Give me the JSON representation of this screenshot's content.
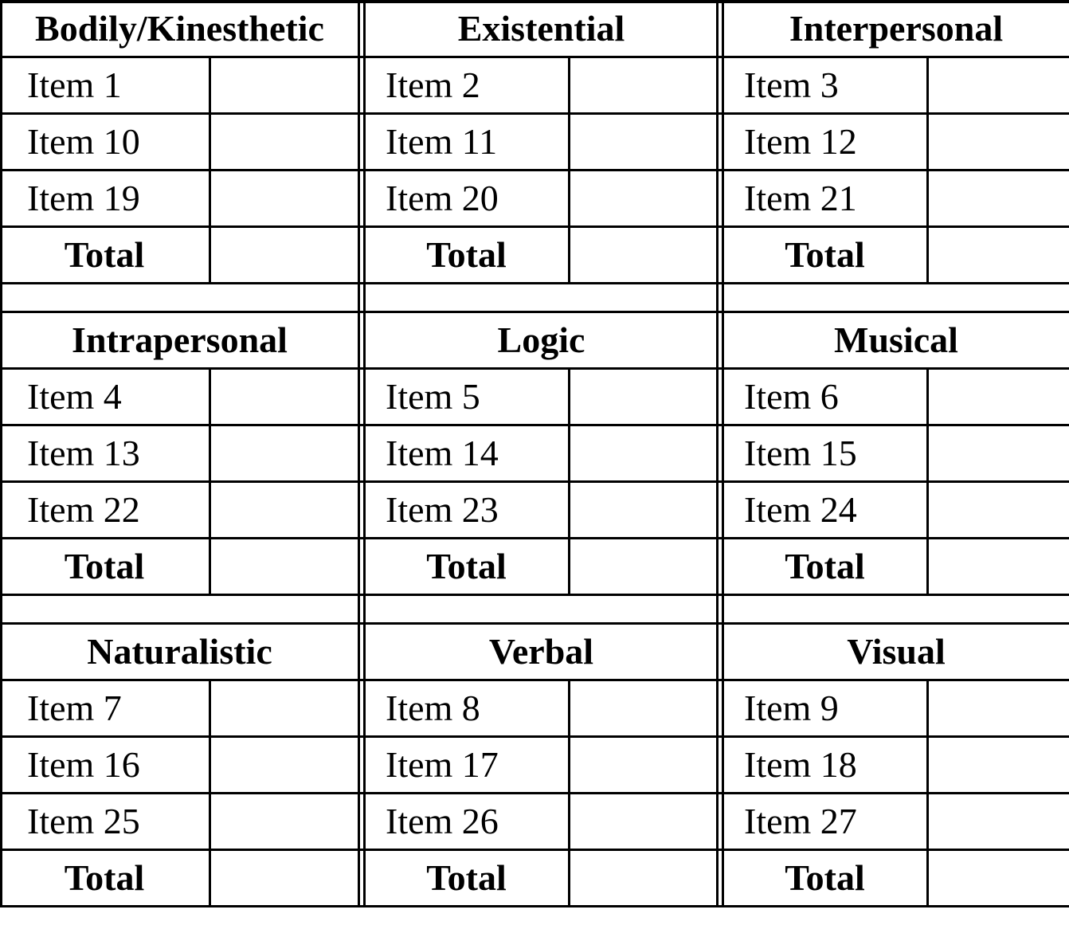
{
  "table": {
    "total_label": "Total",
    "blocks": [
      {
        "groups": [
          {
            "title": "Bodily/Kinesthetic",
            "items": [
              "Item 1",
              "Item 10",
              "Item 19"
            ],
            "values": [
              "",
              "",
              ""
            ],
            "total": ""
          },
          {
            "title": "Existential",
            "items": [
              "Item 2",
              "Item 11",
              "Item 20"
            ],
            "values": [
              "",
              "",
              ""
            ],
            "total": ""
          },
          {
            "title": "Interpersonal",
            "items": [
              "Item 3",
              "Item 12",
              "Item 21"
            ],
            "values": [
              "",
              "",
              ""
            ],
            "total": ""
          }
        ]
      },
      {
        "groups": [
          {
            "title": "Intrapersonal",
            "items": [
              "Item 4",
              "Item 13",
              "Item 22"
            ],
            "values": [
              "",
              "",
              ""
            ],
            "total": ""
          },
          {
            "title": "Logic",
            "items": [
              "Item 5",
              "Item 14",
              "Item 23"
            ],
            "values": [
              "",
              "",
              ""
            ],
            "total": ""
          },
          {
            "title": "Musical",
            "items": [
              "Item 6",
              "Item 15",
              "Item 24"
            ],
            "values": [
              "",
              "",
              ""
            ],
            "total": ""
          }
        ]
      },
      {
        "groups": [
          {
            "title": "Naturalistic",
            "items": [
              "Item 7",
              "Item 16",
              "Item 25"
            ],
            "values": [
              "",
              "",
              ""
            ],
            "total": ""
          },
          {
            "title": "Verbal",
            "items": [
              "Item 8",
              "Item 17",
              "Item 26"
            ],
            "values": [
              "",
              "",
              ""
            ],
            "total": ""
          },
          {
            "title": "Visual",
            "items": [
              "Item 9",
              "Item 18",
              "Item 27"
            ],
            "values": [
              "",
              "",
              ""
            ],
            "total": ""
          }
        ]
      }
    ]
  }
}
